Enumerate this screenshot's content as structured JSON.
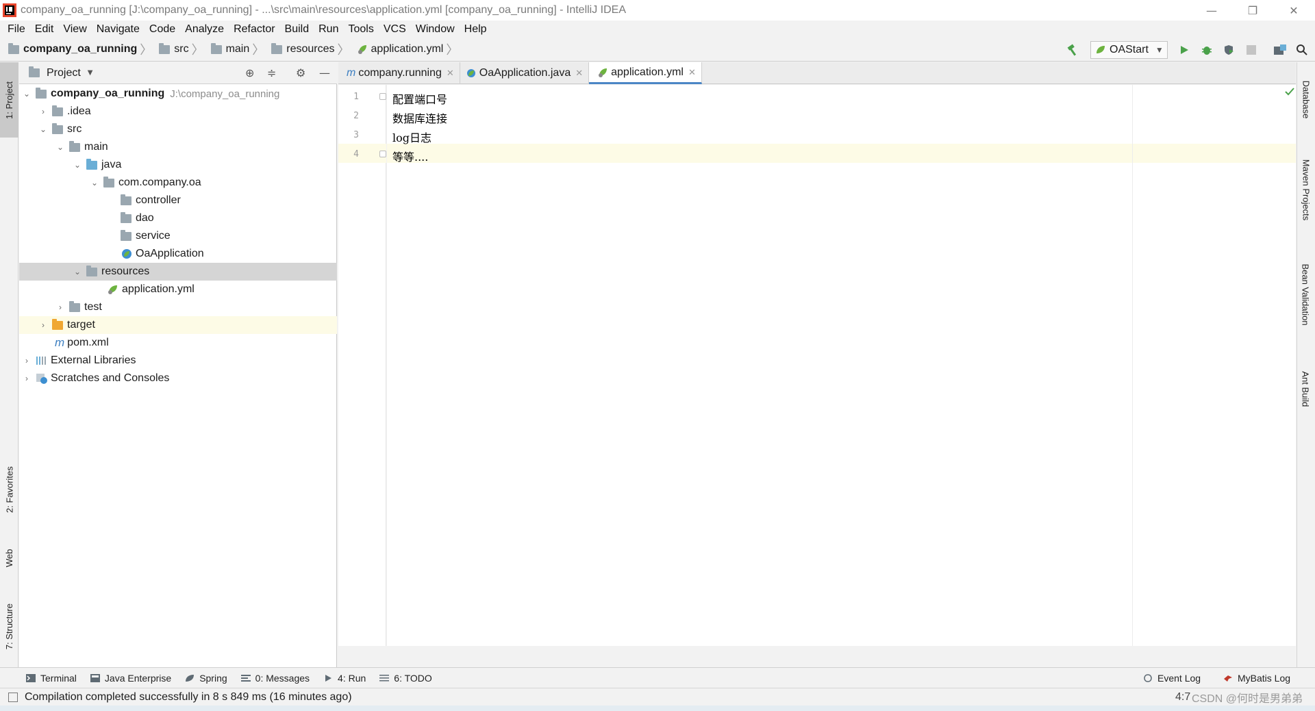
{
  "window": {
    "title": "company_oa_running [J:\\company_oa_running] - ...\\src\\main\\resources\\application.yml [company_oa_running] - IntelliJ IDEA",
    "minimize": "—",
    "maximize": "❐",
    "close": "✕"
  },
  "menu": [
    "File",
    "Edit",
    "View",
    "Navigate",
    "Code",
    "Analyze",
    "Refactor",
    "Build",
    "Run",
    "Tools",
    "VCS",
    "Window",
    "Help"
  ],
  "breadcrumb": {
    "project": "company_oa_running",
    "src": "src",
    "main": "main",
    "resources": "resources",
    "file": "application.yml"
  },
  "toolbar": {
    "run_config": "OAStart"
  },
  "left_strip": {
    "project": "1: Project",
    "favorites": "2: Favorites",
    "web": "Web",
    "structure": "7: Structure"
  },
  "right_strip": {
    "database": "Database",
    "maven": "Maven Projects",
    "bean": "Bean Validation",
    "ant": "Ant Build"
  },
  "project_panel": {
    "title": "Project",
    "tree": {
      "root": "company_oa_running",
      "root_path": "J:\\company_oa_running",
      "idea": ".idea",
      "src": "src",
      "main": "main",
      "java": "java",
      "package": "com.company.oa",
      "controller": "controller",
      "dao": "dao",
      "service": "service",
      "oaapp": "OaApplication",
      "resources": "resources",
      "appyml": "application.yml",
      "test": "test",
      "target": "target",
      "pom": "pom.xml",
      "extlibs": "External Libraries",
      "scratches": "Scratches and Consoles"
    }
  },
  "editor": {
    "tabs": {
      "t1": "company.running",
      "t2": "OaApplication.java",
      "t3": "application.yml"
    },
    "lines": [
      "配置端口号",
      "数据库连接",
      "log日志",
      "等等...."
    ],
    "line_numbers": [
      "1",
      "2",
      "3",
      "4"
    ]
  },
  "bottom_tools": {
    "terminal": "Terminal",
    "java_ee": "Java Enterprise",
    "spring": "Spring",
    "messages": "0: Messages",
    "run": "4: Run",
    "todo": "6: TODO",
    "event_log": "Event Log",
    "mybatis": "MyBatis Log"
  },
  "status": {
    "message": "Compilation completed successfully in 8 s 849 ms (16 minutes ago)",
    "position": "4:7",
    "watermark": "CSDN @何时是男弟弟"
  },
  "colors": {
    "selection": "#d5d5d5",
    "current_line": "#fdfbe6",
    "active_tab_underline": "#4b86c6",
    "run_green": "#4aa14a"
  }
}
